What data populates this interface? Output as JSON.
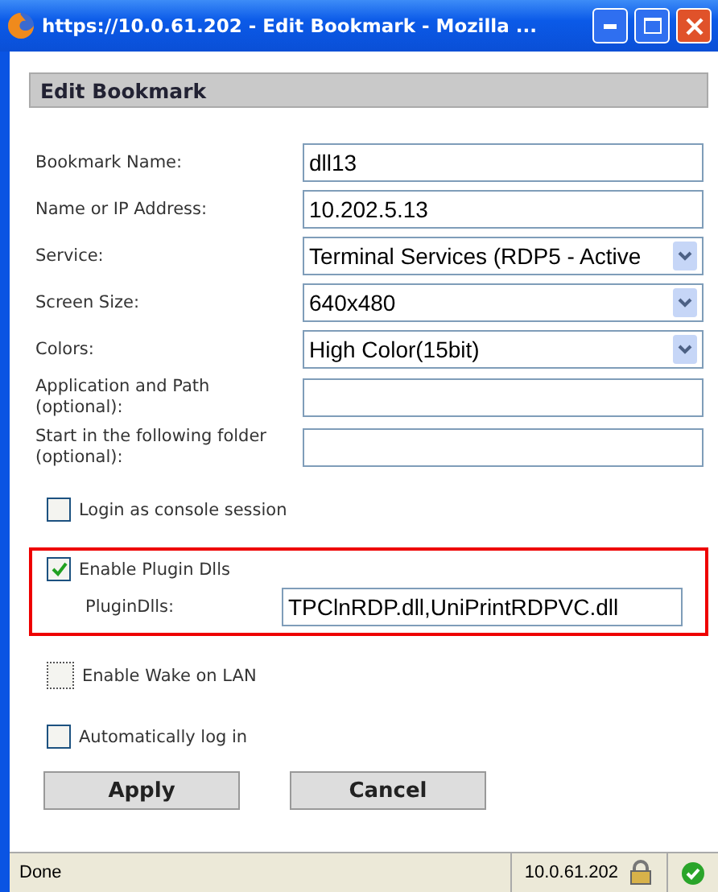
{
  "window": {
    "title": "https://10.0.61.202 - Edit Bookmark - Mozilla ..."
  },
  "header": "Edit Bookmark",
  "fields": [
    {
      "label": "Bookmark Name:",
      "kind": "text",
      "value": "dll13"
    },
    {
      "label": "Name or IP Address:",
      "kind": "text",
      "value": "10.202.5.13"
    },
    {
      "label": "Service:",
      "kind": "select",
      "value": "Terminal Services (RDP5 - Active"
    },
    {
      "label": "Screen Size:",
      "kind": "select",
      "value": "640x480"
    },
    {
      "label": "Colors:",
      "kind": "select",
      "value": "High Color(15bit)"
    },
    {
      "label": "Application and Path (optional):",
      "kind": "text"
    },
    {
      "label": "Start in the following folder (optional):",
      "kind": "text"
    }
  ],
  "options": [
    {
      "label": "Login as console session",
      "checked": false,
      "focused": false
    },
    {
      "label": "Enable Plugin Dlls",
      "checked": true,
      "focused": false,
      "highlighted": true,
      "sub_field": {
        "label": "PluginDlls:",
        "value": "TPClnRDP.dll,UniPrintRDPVC.dll"
      }
    },
    {
      "label": "Enable Wake on LAN",
      "checked": false,
      "focused": true
    },
    {
      "label": "Automatically log in",
      "checked": false,
      "focused": false
    }
  ],
  "buttons": [
    "Apply",
    "Cancel"
  ],
  "status_bar": {
    "text": "Done",
    "host": "10.0.61.202"
  }
}
